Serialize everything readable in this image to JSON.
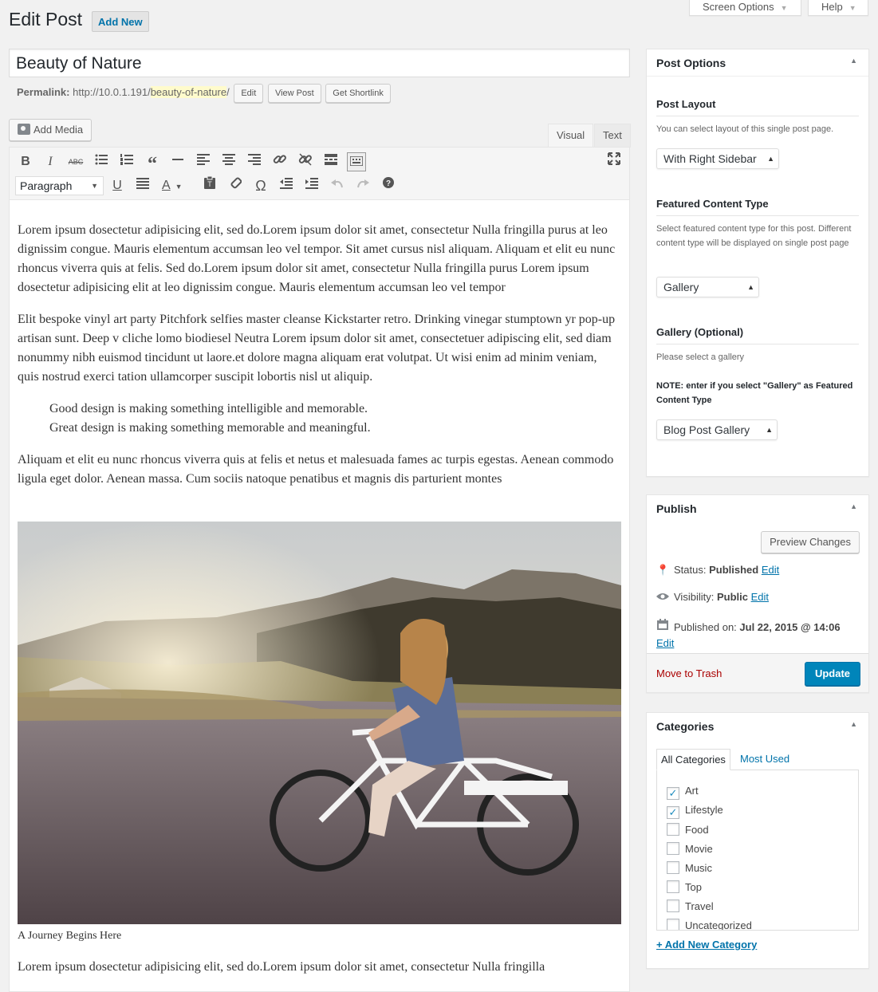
{
  "screen_meta": {
    "screen_options_label": "Screen Options",
    "help_label": "Help"
  },
  "header": {
    "title": "Edit Post",
    "add_new_label": "Add New"
  },
  "post": {
    "title": "Beauty of Nature",
    "permalink_label": "Permalink:",
    "permalink_base": "http://10.0.1.191/",
    "permalink_slug": "beauty-of-nature",
    "permalink_end": "/",
    "edit_label": "Edit",
    "view_post_label": "View Post",
    "get_shortlink_label": "Get Shortlink"
  },
  "editor": {
    "add_media_label": "Add Media",
    "tab_visual": "Visual",
    "tab_text": "Text",
    "format_select": "Paragraph",
    "paragraphs": [
      "Lorem ipsum dosectetur adipisicing elit, sed do.Lorem ipsum dolor sit amet, consectetur Nulla fringilla purus at leo dignissim congue. Mauris elementum accumsan leo vel tempor. Sit amet cursus nisl aliquam. Aliquam et elit eu nunc rhoncus viverra quis at felis. Sed do.Lorem ipsum dolor sit amet, consectetur Nulla fringilla purus Lorem ipsum dosectetur adipisicing elit at leo dignissim congue. Mauris elementum accumsan leo vel tempor",
      "Elit bespoke vinyl art party Pitchfork selfies master cleanse Kickstarter retro. Drinking vinegar stumptown yr pop-up artisan sunt. Deep v cliche lomo biodiesel Neutra Lorem ipsum dolor sit amet, consectetuer adipiscing elit, sed diam nonummy nibh euismod tincidunt ut laore.et dolore magna aliquam erat volutpat. Ut wisi enim ad minim veniam, quis nostrud exerci tation ullamcorper suscipit lobortis nisl ut aliquip."
    ],
    "quote_line1": "Good design is making something intelligible and memorable.",
    "quote_line2": "Great design is making something memorable and meaningful.",
    "paragraph3": "Aliquam et elit eu nunc rhoncus viverra quis at felis et netus et malesuada fames ac turpis egestas. Aenean commodo ligula eget dolor. Aenean massa. Cum sociis natoque penatibus et magnis dis parturient montes",
    "image_caption": "A Journey Begins Here",
    "paragraph_after": "Lorem ipsum dosectetur adipisicing elit, sed do.Lorem ipsum dolor sit amet, consectetur Nulla fringilla"
  },
  "post_options": {
    "title": "Post Options",
    "layout_title": "Post Layout",
    "layout_desc": "You can select layout of this single post page.",
    "layout_value": "With Right Sidebar",
    "featured_title": "Featured Content Type",
    "featured_desc": "Select featured content type for this post. Different content type will be displayed on single post page",
    "featured_value": "Gallery",
    "gallery_title": "Gallery (Optional)",
    "gallery_desc": "Please select a gallery",
    "gallery_note": "NOTE: enter if you select \"Gallery\" as Featured Content Type",
    "gallery_value": "Blog Post Gallery"
  },
  "publish": {
    "title": "Publish",
    "preview_label": "Preview Changes",
    "status_label": "Status:",
    "status_value": "Published",
    "visibility_label": "Visibility:",
    "visibility_value": "Public",
    "published_label": "Published on:",
    "published_value": "Jul 22, 2015 @ 14:06",
    "edit_link": "Edit",
    "trash_label": "Move to Trash",
    "update_label": "Update"
  },
  "categories": {
    "title": "Categories",
    "tab_all": "All Categories",
    "tab_used": "Most Used",
    "items": [
      {
        "label": "Art",
        "checked": true
      },
      {
        "label": "Lifestyle",
        "checked": true
      },
      {
        "label": "Food",
        "checked": false
      },
      {
        "label": "Movie",
        "checked": false
      },
      {
        "label": "Music",
        "checked": false
      },
      {
        "label": "Top",
        "checked": false
      },
      {
        "label": "Travel",
        "checked": false
      },
      {
        "label": "Uncategorized",
        "checked": false
      }
    ],
    "add_new_label": "+ Add New Category"
  },
  "colors": {
    "primary_button": "#0085ba",
    "link": "#0073aa",
    "trash": "#a00",
    "slug_highlight": "#fffbcc"
  }
}
